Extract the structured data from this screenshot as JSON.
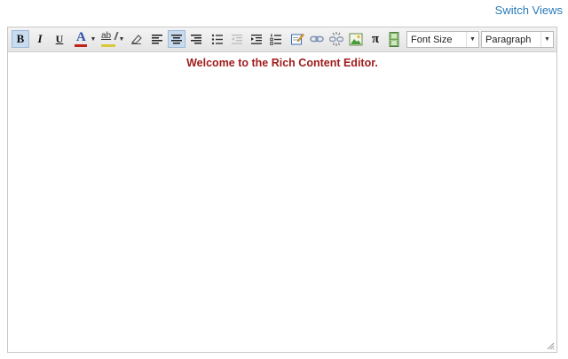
{
  "header": {
    "switch_views_label": "Switch Views"
  },
  "toolbar": {
    "bold_glyph": "B",
    "italic_glyph": "I",
    "underline_glyph": "U",
    "font_color_glyph": "A",
    "highlight_glyph": "ab",
    "pi_glyph": "π",
    "font_size_label": "Font Size",
    "format_label": "Paragraph",
    "colors": {
      "font_color_swatch": "#c0231e",
      "highlight_swatch": "#d8c83a",
      "active_bg": "#c9dcef"
    },
    "icons": [
      "bold-icon",
      "italic-icon",
      "underline-icon",
      "font-color-icon",
      "highlight-color-icon",
      "eraser-icon",
      "align-left-icon",
      "align-center-icon",
      "align-right-icon",
      "bullet-list-icon",
      "outdent-icon",
      "indent-icon",
      "numbered-list-icon",
      "edit-note-icon",
      "link-icon",
      "unlink-icon",
      "image-icon",
      "pi-icon",
      "film-icon",
      "resize-handle-icon"
    ],
    "active_button": "align-center"
  },
  "content": {
    "welcome_text": "Welcome to the Rich Content Editor.",
    "text_color": "#a01d1d"
  }
}
